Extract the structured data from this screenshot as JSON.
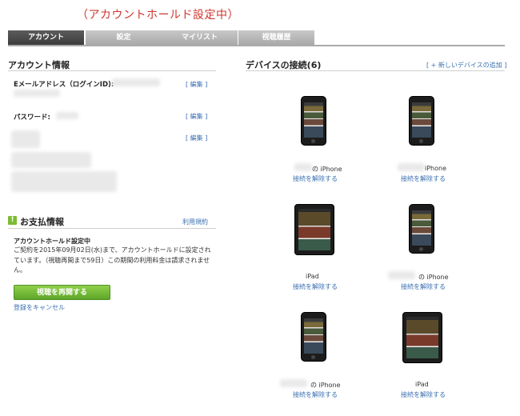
{
  "banner": "（アカウントホールド設定中）",
  "tabs": [
    {
      "label": "アカウント",
      "active": true
    },
    {
      "label": "設定",
      "active": false
    },
    {
      "label": "マイリスト",
      "active": false
    },
    {
      "label": "視聴履歴",
      "active": false
    }
  ],
  "account": {
    "title": "アカウント情報",
    "email_label": "Eメールアドレス（ログインID):",
    "password_label": "パスワード:",
    "edit": "[ 編集 ]"
  },
  "payment": {
    "title": "お支払情報",
    "terms_link": "利用規約",
    "hold_title": "アカウントホールド設定中",
    "hold_body": "ご契約を2015年09月02日(水)まで、アカウントホールドに設定されています。（視聴再開まで59日）この期間の利用料金は請求されません。",
    "resume_button": "視聴を再開する",
    "cancel_link": "登録をキャンセル"
  },
  "devices": {
    "title": "デバイスの接続(6)",
    "add_link": "[ + 新しいデバイスの追加 ]",
    "disconnect_label": "接続を解除する",
    "items": [
      {
        "type": "iphone",
        "name": "の iPhone"
      },
      {
        "type": "iphone",
        "name": "iPhone"
      },
      {
        "type": "ipad",
        "name": "iPad"
      },
      {
        "type": "iphone",
        "name": "の iPhone"
      },
      {
        "type": "iphone",
        "name": "の iPhone"
      },
      {
        "type": "ipad",
        "name": "iPad"
      }
    ]
  },
  "colors": {
    "banner": "#d0352e",
    "link": "#3a6fb0",
    "active_tab": "#4a4a4a",
    "button": "#6fb836"
  }
}
